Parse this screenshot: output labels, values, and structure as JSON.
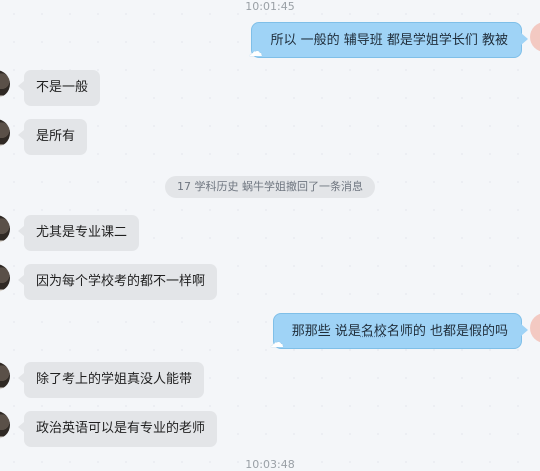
{
  "timestamps": {
    "top": "10:01:45",
    "bottom": "10:03:48"
  },
  "messages": {
    "m1": "所以 一般的 辅导班 都是学姐学长们 教被",
    "m2": "不是一般",
    "m3": "是所有",
    "m4": "尤其是专业课二",
    "m5": "因为每个学校考的都不一样啊",
    "m6_prefix": "那那些 说是",
    "m6_link": "名校",
    "m6_suffix": "名师的 也都是假的吗",
    "m7": "除了考上的学姐真没人能带",
    "m8": "政治英语可以是有专业的老师"
  },
  "system_notice": "17 学科历史 蜗牛学姐撤回了一条消息",
  "colors": {
    "self_bubble": "#9fd3f6",
    "other_bubble": "#e3e5e8",
    "background": "#f4f6f9"
  },
  "icons": {
    "cloud": "☁"
  }
}
